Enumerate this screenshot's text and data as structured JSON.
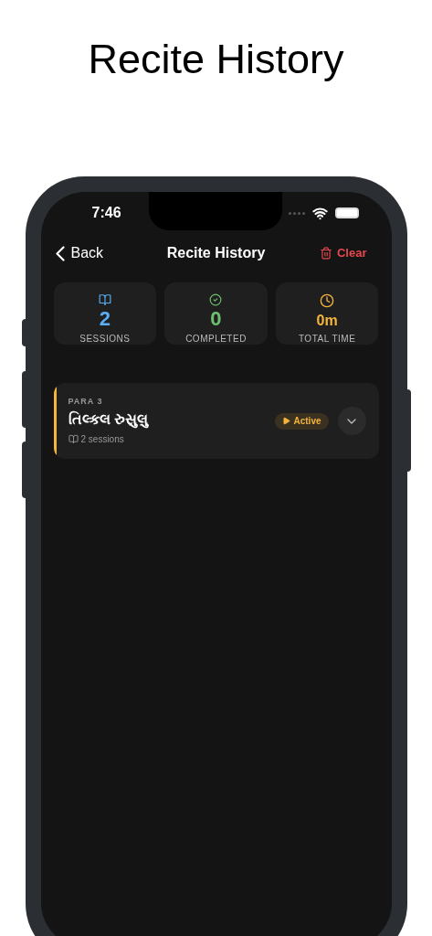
{
  "page_title": "Recite History",
  "status_bar": {
    "time": "7:46"
  },
  "nav": {
    "back": "Back",
    "title": "Recite History",
    "action": "Clear"
  },
  "stats": [
    {
      "kind": "sessions",
      "value": "2",
      "label": "SESSIONS"
    },
    {
      "kind": "completed",
      "value": "0",
      "label": "COMPLETED"
    },
    {
      "kind": "time",
      "value": "0m",
      "label": "TOTAL TIME"
    }
  ],
  "entries": [
    {
      "section": "PARA 3",
      "title": "તિલ્કલ રુસુલુ",
      "sessions": "2 sessions",
      "status": "Active",
      "kind": "active",
      "expanded": false
    }
  ]
}
